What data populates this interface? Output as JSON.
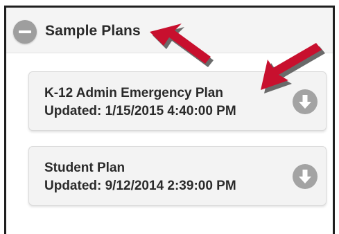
{
  "header": {
    "title": "Sample Plans",
    "toggle_icon": "minus-circle-icon"
  },
  "plans": [
    {
      "name": "K-12 Admin Emergency Plan",
      "updated": "Updated: 1/15/2015 4:40:00 PM",
      "action_icon": "download-arrow-icon"
    },
    {
      "name": "Student Plan",
      "updated": "Updated: 9/12/2014 2:39:00 PM",
      "action_icon": "download-arrow-icon"
    }
  ],
  "colors": {
    "annotation_arrow": "#c8102e",
    "icon_gray": "#a3a3a3",
    "card_bg": "#f3f3f3",
    "text": "#2a2a2a"
  }
}
